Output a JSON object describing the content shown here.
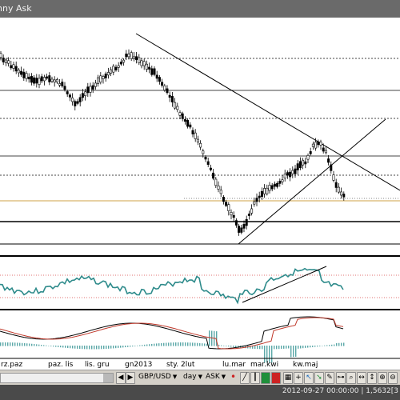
{
  "window": {
    "title": "nny Ask"
  },
  "axis": {
    "x_labels": [
      "rz.paz",
      "paz. lis",
      "lis. gru",
      "gn2013",
      "sty. 2lut",
      "lu.mar",
      "mar.kwi",
      "kw.maj"
    ]
  },
  "toolbar": {
    "symbol": "GBP/USD",
    "timeframe": "day",
    "price_type": "ASK",
    "marker": "•"
  },
  "status": {
    "text": "2012-09-27 00:00:00 | 1,5632[3"
  },
  "colors": {
    "oscillator": "#2e8b8b",
    "macd_signal": "#c0392b",
    "hist": "#5aa7a7",
    "price_line": "#d4b24c",
    "red_line": "#e07070"
  }
}
